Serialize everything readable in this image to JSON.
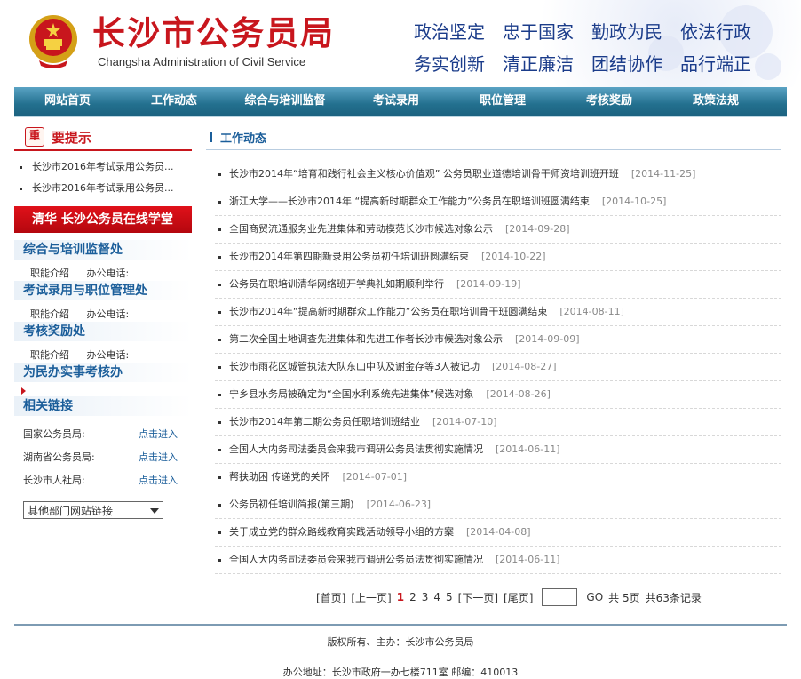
{
  "header": {
    "title_cn": "长沙市公务员局",
    "title_en": "Changsha Administration of Civil Service",
    "slogans": [
      [
        "政治坚定",
        "忠于国家",
        "勤政为民",
        "依法行政"
      ],
      [
        "务实创新",
        "清正廉洁",
        "团结协作",
        "品行端正"
      ]
    ]
  },
  "nav": [
    "网站首页",
    "工作动态",
    "综合与培训监督",
    "考试录用",
    "职位管理",
    "考核奖励",
    "政策法规"
  ],
  "tips": {
    "badge": "重",
    "title": "要提示",
    "items": [
      "长沙市2016年考试录用公务员...",
      "长沙市2016年考试录用公务员..."
    ]
  },
  "banner": "清华 长沙公务员在线学堂",
  "sections": [
    {
      "title": "综合与培训监督处",
      "intro": "职能介绍",
      "tel": "办公电话:"
    },
    {
      "title": "考试录用与职位管理处",
      "intro": "职能介绍",
      "tel": "办公电话:"
    },
    {
      "title": "考核奖励处",
      "intro": "职能介绍",
      "tel": "办公电话:"
    },
    {
      "title": "为民办实事考核办",
      "intro": "",
      "tel": ""
    }
  ],
  "links": {
    "title": "相关链接",
    "items": [
      {
        "label": "国家公务员局:",
        "action": "点击进入"
      },
      {
        "label": "湖南省公务员局:",
        "action": "点击进入"
      },
      {
        "label": "长沙市人社局:",
        "action": "点击进入"
      }
    ],
    "select": "其他部门网站链接"
  },
  "main": {
    "title": "工作动态",
    "news": [
      {
        "title": "长沙市2014年“培育和践行社会主义核心价值观” 公务员职业道德培训骨干师资培训班开班",
        "date": "[2014-11-25]"
      },
      {
        "title": "浙江大学——长沙市2014年 “提高新时期群众工作能力”公务员在职培训班圆满结束",
        "date": "[2014-10-25]"
      },
      {
        "title": "全国商贸流通服务业先进集体和劳动模范长沙市候选对象公示",
        "date": "[2014-09-28]"
      },
      {
        "title": "长沙市2014年第四期新录用公务员初任培训班圆满结束",
        "date": "[2014-10-22]"
      },
      {
        "title": "公务员在职培训清华网络班开学典礼如期顺利举行",
        "date": "[2014-09-19]"
      },
      {
        "title": "长沙市2014年“提高新时期群众工作能力”公务员在职培训骨干班圆满结束",
        "date": "[2014-08-11]"
      },
      {
        "title": "第二次全国土地调查先进集体和先进工作者长沙市候选对象公示",
        "date": "[2014-09-09]"
      },
      {
        "title": "长沙市雨花区城管执法大队东山中队及谢金存等3人被记功",
        "date": "[2014-08-27]"
      },
      {
        "title": "宁乡县水务局被确定为“全国水利系统先进集体”候选对象",
        "date": "[2014-08-26]"
      },
      {
        "title": "长沙市2014年第二期公务员任职培训班结业",
        "date": "[2014-07-10]"
      },
      {
        "title": "全国人大内务司法委员会来我市调研公务员法贯彻实施情况",
        "date": "[2014-06-11]"
      },
      {
        "title": "帮扶助困 传递党的关怀",
        "date": "[2014-07-01]"
      },
      {
        "title": "公务员初任培训简报(第三期)",
        "date": "[2014-06-23]"
      },
      {
        "title": "关于成立党的群众路线教育实践活动领导小组的方案",
        "date": "[2014-04-08]"
      },
      {
        "title": "全国人大内务司法委员会来我市调研公务员法贯彻实施情况",
        "date": "[2014-06-11]"
      }
    ]
  },
  "pager": {
    "first": "[首页]",
    "prev": "[上一页]",
    "pages": [
      "1",
      "2",
      "3",
      "4",
      "5"
    ],
    "next": "[下一页]",
    "last": "[尾页]",
    "go": "GO",
    "total_pages": "共 5页",
    "total_records": "共63条记录"
  },
  "footer": {
    "copyright": "版权所有、主办：长沙市公务员局",
    "address": "办公地址：长沙市政府一办七楼711室   邮编：410013"
  }
}
